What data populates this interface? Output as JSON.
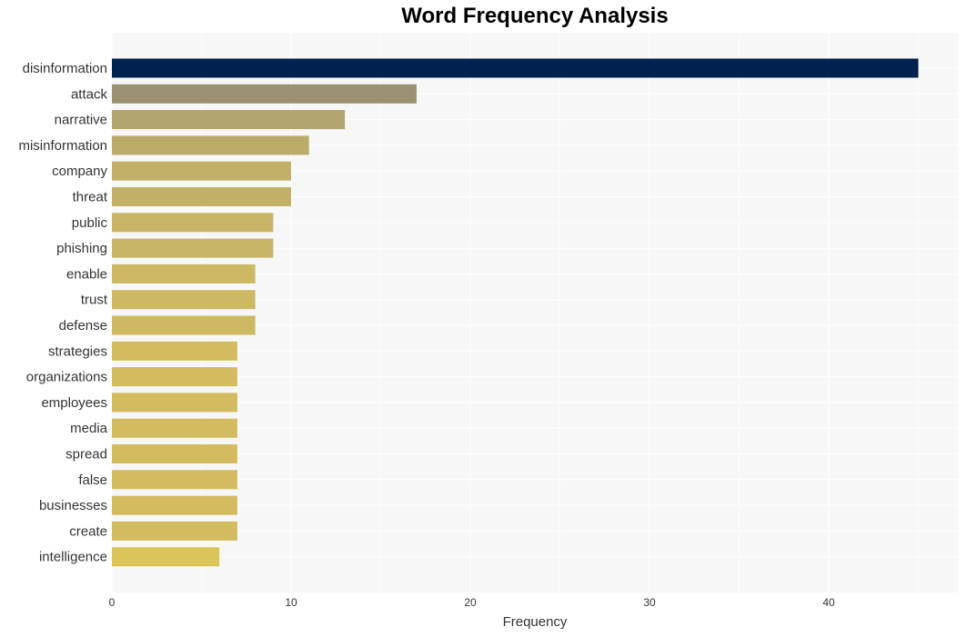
{
  "chart_data": {
    "type": "bar",
    "orientation": "horizontal",
    "title": "Word Frequency Analysis",
    "xlabel": "Frequency",
    "ylabel": "",
    "xlim": [
      0,
      47.2
    ],
    "xticks": [
      0,
      10,
      20,
      30,
      40
    ],
    "grid": true,
    "categories": [
      "disinformation",
      "attack",
      "narrative",
      "misinformation",
      "company",
      "threat",
      "public",
      "phishing",
      "enable",
      "trust",
      "defense",
      "strategies",
      "organizations",
      "employees",
      "media",
      "spread",
      "false",
      "businesses",
      "create",
      "intelligence"
    ],
    "values": [
      45,
      17,
      13,
      11,
      10,
      10,
      9,
      9,
      8,
      8,
      8,
      7,
      7,
      7,
      7,
      7,
      7,
      7,
      7,
      6
    ],
    "colors": [
      "#00224e",
      "#9b9172",
      "#b1a46f",
      "#baab6b",
      "#c2b069",
      "#c2b069",
      "#c7b466",
      "#c7b466",
      "#cdb863",
      "#cdb863",
      "#cdb863",
      "#d3bc5f",
      "#d3bc5f",
      "#d3bc5f",
      "#d3bc5f",
      "#d3bc5f",
      "#d3bc5f",
      "#d3bc5f",
      "#d3bc5f",
      "#dbc559"
    ]
  }
}
